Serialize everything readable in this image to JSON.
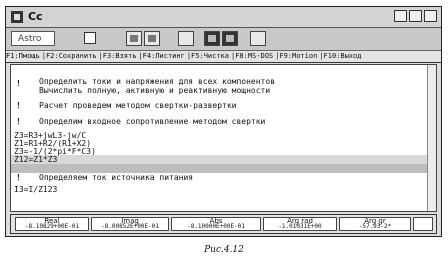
{
  "window": {
    "title": "Cc"
  },
  "toolbar": {
    "combo_value": "Astro"
  },
  "fkeys": [
    "F1:Пмощь",
    "F2:Сохранить",
    "F3:Взять",
    "F4:Листинг",
    "F5:Чистка",
    "F8:MS-DOS",
    "F9:Мотion",
    "F10:Выход"
  ],
  "content": {
    "lines": [
      {
        "bullet": "!",
        "text": "Определить токи и напряжения для всех компонентов"
      },
      {
        "bullet": "",
        "text": "Вычислить полную, активную и реактивную мощности"
      },
      {
        "bullet": "!",
        "text": "Расчет проведем методом свертки-развертки"
      },
      {
        "bullet": "!",
        "text": "Определим входное сопротивление методом свертки"
      },
      {
        "bullet": "",
        "text": "Z3=R3+jwL3-jw/C"
      },
      {
        "bullet": "",
        "text": "Z1=R1+R2/(R1+X2)"
      },
      {
        "bullet": "",
        "text": "Z3=-1/(2*pi*F*C3)"
      },
      {
        "bullet": "",
        "text": "Z12=Z1*Z3"
      },
      {
        "bullet": "!",
        "text": "Определяем ток источника питания"
      },
      {
        "bullet": "",
        "text": "I3=I/Z123"
      }
    ]
  },
  "status": [
    {
      "label": "Real",
      "value": "-8.10829+00E-01"
    },
    {
      "label": "Imag",
      "value": "-8.00852E+00E-01"
    },
    {
      "label": "Abs",
      "value": "-8.10000E+00E-01"
    },
    {
      "label": "Arg rad",
      "value": "-1.01031E+00"
    },
    {
      "label": "Arg gr",
      "value": "-57.93-2*"
    },
    {
      "label": "",
      "value": ""
    }
  ],
  "caption": "Рис.4.12"
}
